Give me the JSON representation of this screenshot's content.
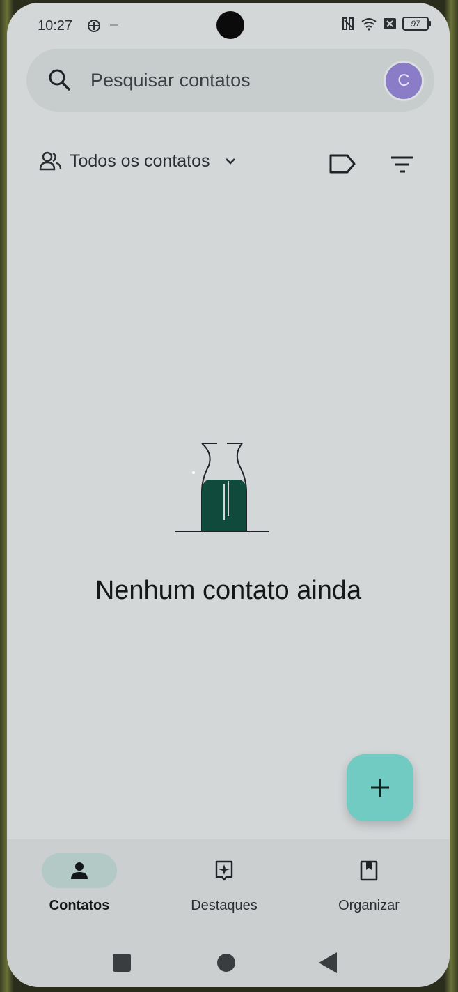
{
  "status_bar": {
    "time": "10:27",
    "battery": "97",
    "icons": [
      "vpn-icon",
      "nfc-icon",
      "wifi-icon",
      "sim-off-icon",
      "battery-icon"
    ]
  },
  "search": {
    "placeholder": "Pesquisar contatos",
    "avatar_initial": "C"
  },
  "filter_bar": {
    "label": "Todos os contatos",
    "icons": [
      "contacts-group-icon",
      "chevron-down-icon",
      "label-icon",
      "filter-list-icon"
    ]
  },
  "empty_state": {
    "message": "Nenhum contato ainda",
    "illustration": "empty-bottle-illustration"
  },
  "fab": {
    "icon": "plus-icon"
  },
  "bottom_nav": {
    "items": [
      {
        "label": "Contatos",
        "icon": "person-icon",
        "active": true
      },
      {
        "label": "Destaques",
        "icon": "sparkle-badge-icon",
        "active": false
      },
      {
        "label": "Organizar",
        "icon": "bookmark-book-icon",
        "active": false
      }
    ]
  },
  "colors": {
    "background": "#d3d7d8",
    "search_bar": "#c7cdcd",
    "avatar": "#8a7cc7",
    "fab": "#71cbc3",
    "bottle_liquid": "#0f4a3c",
    "active_nav_pill": "#b3c9c5"
  }
}
